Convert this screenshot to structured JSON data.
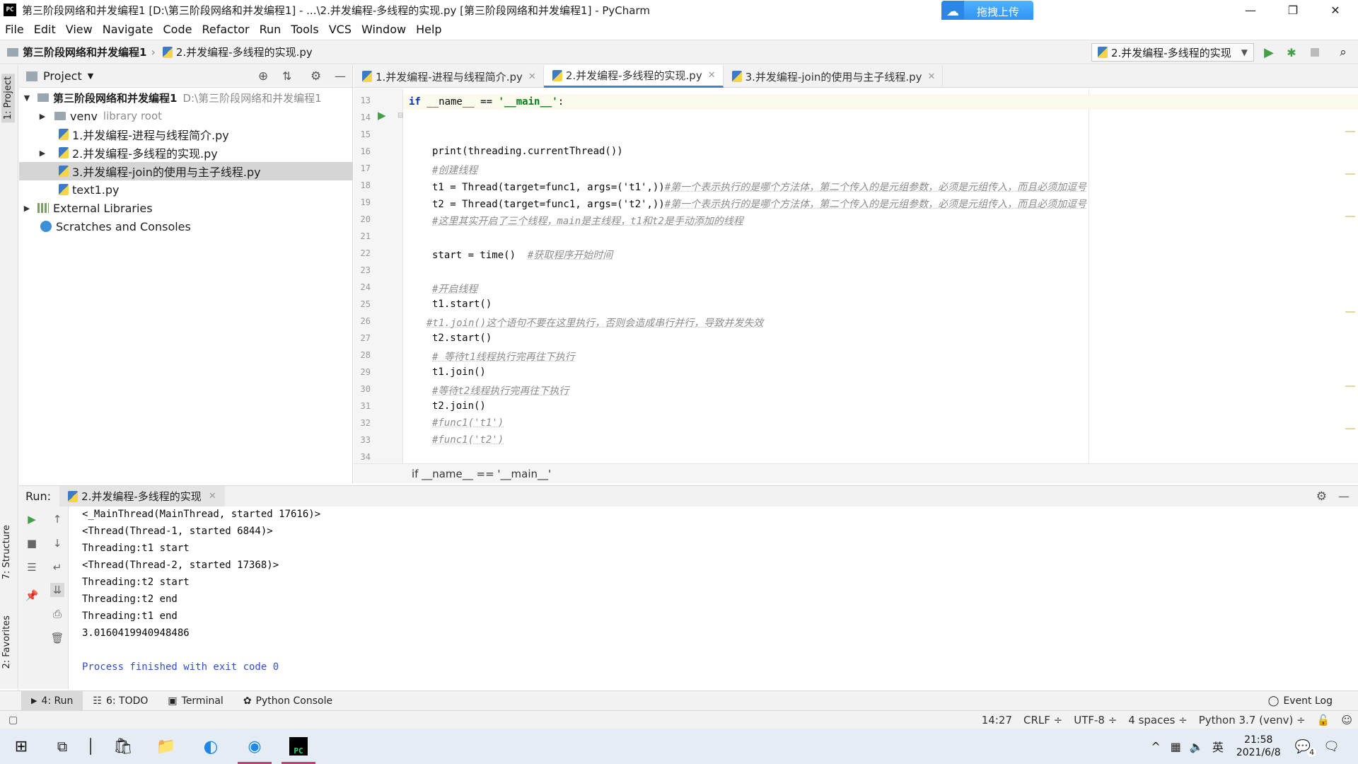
{
  "window": {
    "title": "第三阶段网络和并发编程1 [D:\\第三阶段网络和并发编程1] - ...\\2.并发编程-多线程的实现.py [第三阶段网络和并发编程1] - PyCharm",
    "app_icon_text": "PC",
    "upload_label": "拖拽上传",
    "controls": [
      "—",
      "❐",
      "✕"
    ]
  },
  "menu": [
    "File",
    "Edit",
    "View",
    "Navigate",
    "Code",
    "Refactor",
    "Run",
    "Tools",
    "VCS",
    "Window",
    "Help"
  ],
  "navbar": {
    "project": "第三阶段网络和并发编程1",
    "file": "2.并发编程-多线程的实现.py",
    "run_config": "2.并发编程-多线程的实现"
  },
  "left_strip": {
    "project_tab": "1: Project",
    "structure_tab": "7: Structure",
    "favorites_tab": "2: Favorites"
  },
  "project_panel": {
    "header": "Project",
    "root_name": "第三阶段网络和并发编程1",
    "root_path": "D:\\第三阶段网络和并发编程1",
    "venv": "venv",
    "venv_note": "library root",
    "files": [
      "1.并发编程-进程与线程简介.py",
      "2.并发编程-多线程的实现.py",
      "3.并发编程-join的使用与主子线程.py",
      "text1.py"
    ],
    "external": "External Libraries",
    "scratches": "Scratches and Consoles"
  },
  "editor_tabs": [
    {
      "label": "1.并发编程-进程与线程简介.py"
    },
    {
      "label": "2.并发编程-多线程的实现.py"
    },
    {
      "label": "3.并发编程-join的使用与主子线程.py"
    }
  ],
  "code": {
    "line_numbers": [
      "13",
      "14",
      "15",
      "16",
      "17",
      "18",
      "19",
      "20",
      "21",
      "22",
      "23",
      "24",
      "25",
      "26",
      "27",
      "28",
      "29",
      "30",
      "31",
      "32",
      "33",
      "34"
    ],
    "l14_kw": "if",
    "l14_rest": " __name__ == ",
    "l14_str": "'__main__'",
    "l14_end": ":",
    "l16": "print(threading.currentThread())",
    "l17": "#创建线程",
    "l18_code": "t1 = Thread(target=func1, args=('t1',))",
    "l18_cm": "#第一个表示执行的是哪个方法体，第二个传入的是元组参数，必须是元组传入，而且必须加逗号",
    "l19_code": "t2 = Thread(target=func1, args=('t2',))",
    "l19_cm": "#第一个表示执行的是哪个方法体，第二个传入的是元组参数，必须是元组传入，而且必须加逗号",
    "l20": "#这里其实开启了三个线程，main是主线程，t1和t2是手动添加的线程",
    "l22_code": "start = time()  ",
    "l22_cm": "#获取程序开始时间",
    "l24": "#开启线程",
    "l25": "t1.start()",
    "l26": "#t1.join()这个语句不要在这里执行，否则会造成串行并行，导致并发失效",
    "l27": "t2.start()",
    "l28": "# 等待t1线程执行完再往下执行",
    "l29": "t1.join()",
    "l30": "#等待t2线程执行完再往下执行",
    "l31": "t2.join()",
    "l32": "#func1('t1')",
    "l33": "#func1('t2')"
  },
  "editor_breadcrumb": "if __name__ == '__main__'",
  "run_panel": {
    "label": "Run:",
    "tab": "2.并发编程-多线程的实现",
    "output": [
      "<_MainThread(MainThread, started 17616)>",
      "<Thread(Thread-1, started 6844)>",
      "Threading:t1 start",
      "<Thread(Thread-2, started 17368)>",
      "Threading:t2 start",
      "Threading:t2 end",
      "Threading:t1 end",
      "3.0160419940948486",
      "",
      "Process finished with exit code 0"
    ]
  },
  "bottom_tools": {
    "run": "4: Run",
    "todo": "6: TODO",
    "terminal": "Terminal",
    "python_console": "Python Console",
    "event_log": "Event Log"
  },
  "status": {
    "position": "14:27",
    "line_sep": "CRLF ÷",
    "encoding": "UTF-8 ÷",
    "indent": "4 spaces ÷",
    "interpreter": "Python 3.7 (venv) ÷"
  },
  "taskbar": {
    "time": "21:58",
    "date": "2021/6/8",
    "ime": "英",
    "notif_count": "4"
  },
  "colors": {
    "accent": "#4083c9",
    "keyword": "#0033b3",
    "string": "#067d17",
    "comment": "#8c8c8c",
    "run_green": "#43a047"
  }
}
